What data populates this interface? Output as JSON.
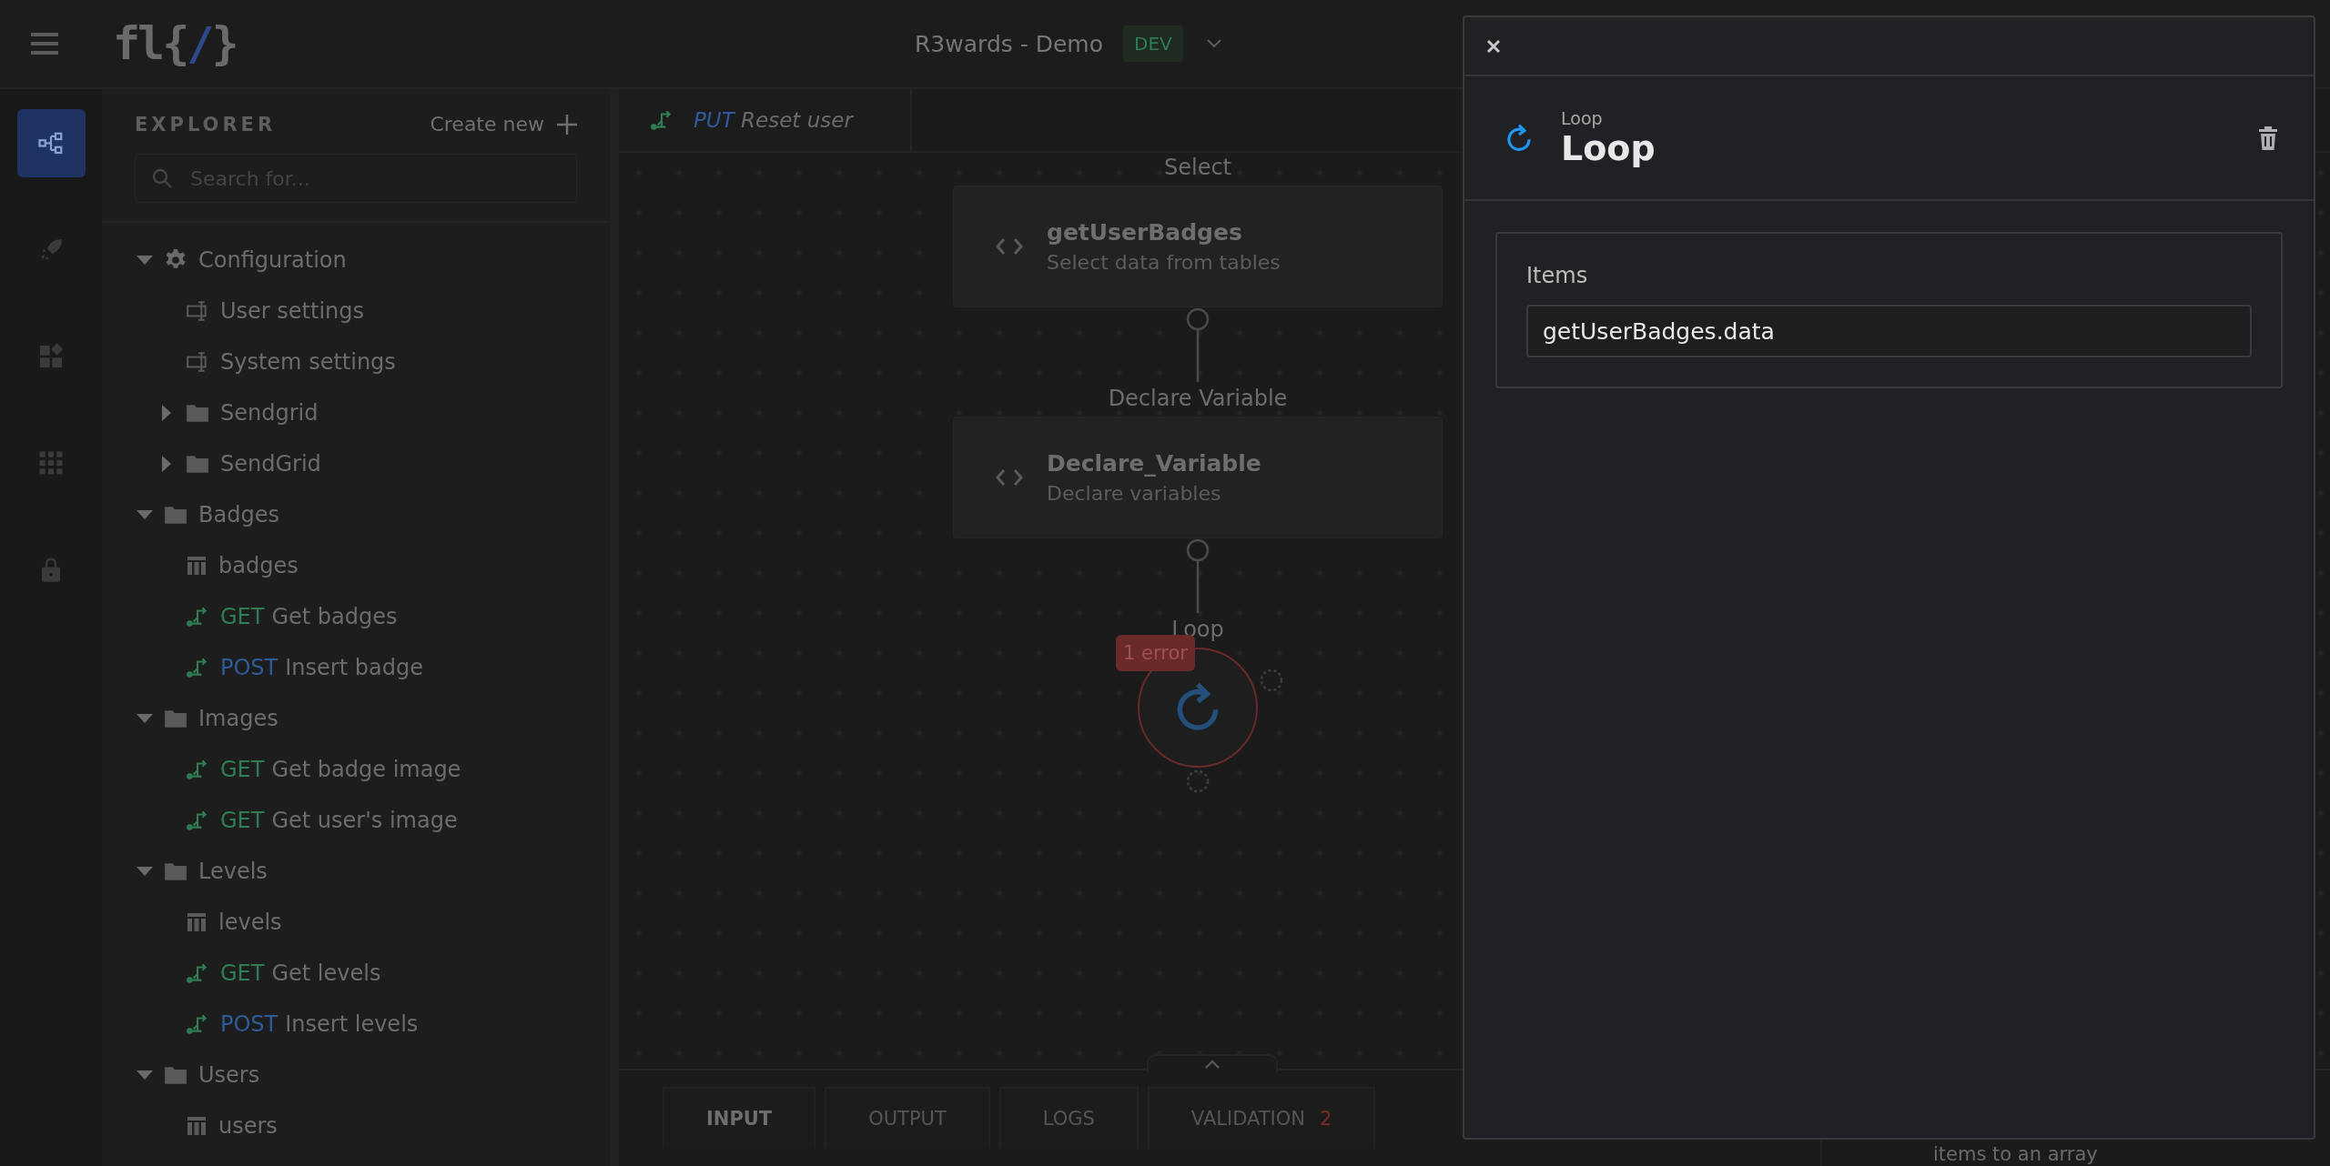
{
  "header": {
    "logo": {
      "text": "fl{",
      "accent": "/",
      "tail": "}"
    },
    "project": "R3wards - Demo",
    "environment": "DEV"
  },
  "rail": [
    {
      "kind": "flow",
      "selected": true
    },
    {
      "kind": "rocket",
      "selected": false
    },
    {
      "kind": "widgets",
      "selected": false
    },
    {
      "kind": "apps",
      "selected": false
    },
    {
      "kind": "lock",
      "selected": false
    }
  ],
  "explorer": {
    "title": "EXPLORER",
    "create": "Create new",
    "search": {
      "placeholder": "Search for..."
    },
    "tree": [
      {
        "kind": "config",
        "label": "Configuration",
        "expanded": true,
        "children": [
          {
            "kind": "settings",
            "label": "User settings"
          },
          {
            "kind": "settings",
            "label": "System settings"
          },
          {
            "kind": "folder",
            "label": "Sendgrid",
            "expanded": false
          },
          {
            "kind": "folder",
            "label": "SendGrid",
            "expanded": false
          }
        ]
      },
      {
        "kind": "folder",
        "label": "Badges",
        "expanded": true,
        "children": [
          {
            "kind": "table",
            "label": "badges"
          },
          {
            "kind": "endpoint",
            "method": "GET",
            "color": "#2e7d55",
            "label": "Get badges"
          },
          {
            "kind": "endpoint",
            "method": "POST",
            "color": "#2f5a9a",
            "label": "Insert badge"
          }
        ]
      },
      {
        "kind": "folder",
        "label": "Images",
        "expanded": true,
        "children": [
          {
            "kind": "endpoint",
            "method": "GET",
            "color": "#2e7d55",
            "label": "Get badge image"
          },
          {
            "kind": "endpoint",
            "method": "GET",
            "color": "#2e7d55",
            "label": "Get user's image"
          }
        ]
      },
      {
        "kind": "folder",
        "label": "Levels",
        "expanded": true,
        "children": [
          {
            "kind": "table",
            "label": "levels"
          },
          {
            "kind": "endpoint",
            "method": "GET",
            "color": "#2e7d55",
            "label": "Get levels"
          },
          {
            "kind": "endpoint",
            "method": "POST",
            "color": "#2f5a9a",
            "label": "Insert levels"
          }
        ]
      },
      {
        "kind": "folder",
        "label": "Users",
        "expanded": true,
        "children": [
          {
            "kind": "table",
            "label": "users"
          }
        ]
      }
    ]
  },
  "canvas": {
    "tab": {
      "method": "PUT",
      "color": "#2f5a9a",
      "label": "Reset user"
    },
    "nodes": [
      {
        "kind": "step",
        "caption": "Select",
        "title": "getUserBadges",
        "subtitle": "Select data from tables"
      },
      {
        "kind": "step",
        "caption": "Declare Variable",
        "title": "Declare_Variable",
        "subtitle": "Declare variables"
      },
      {
        "kind": "loop",
        "caption": "Loop",
        "error": "1 error"
      }
    ]
  },
  "bottom_tabs": [
    {
      "label": "INPUT",
      "selected": true
    },
    {
      "label": "OUTPUT",
      "selected": false
    },
    {
      "label": "LOGS",
      "selected": false
    },
    {
      "label": "VALIDATION",
      "selected": false,
      "count": "2"
    }
  ],
  "side_panel": {
    "text": "items to an array"
  },
  "drawer": {
    "type": "Loop",
    "title": "Loop",
    "fields": [
      {
        "label": "Items",
        "value": "getUserBadges.data"
      }
    ]
  }
}
